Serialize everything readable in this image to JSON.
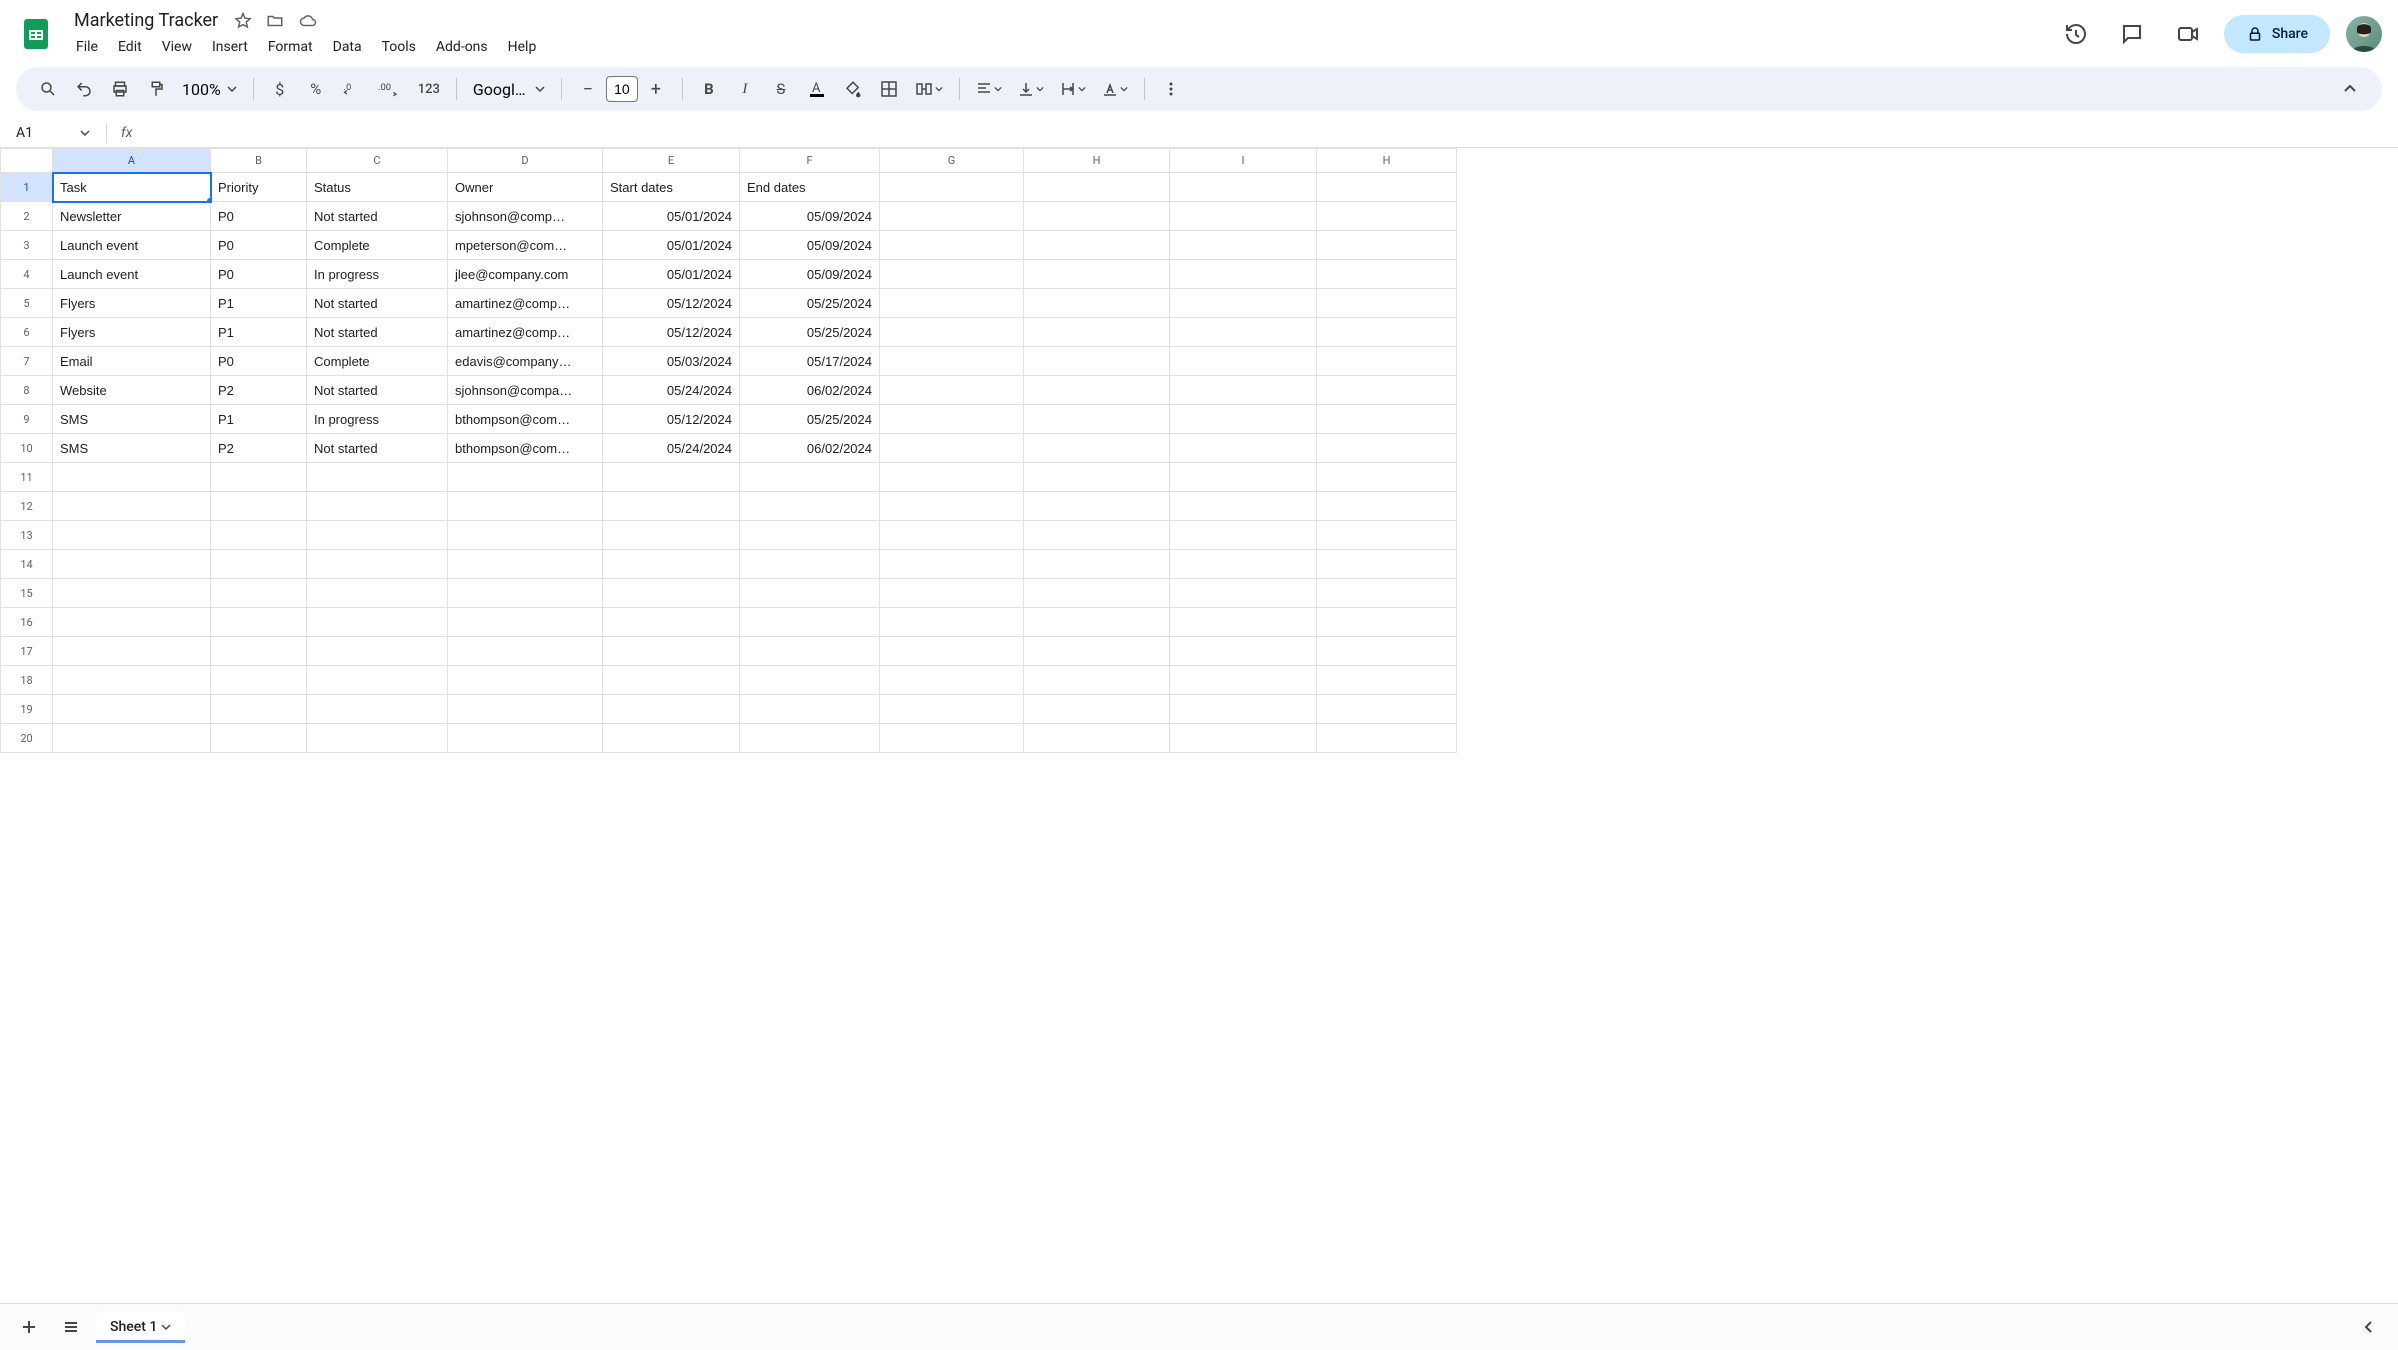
{
  "doc": {
    "title": "Marketing Tracker"
  },
  "menus": [
    "File",
    "Edit",
    "View",
    "Insert",
    "Format",
    "Data",
    "Tools",
    "Add-ons",
    "Help"
  ],
  "toolbar": {
    "zoom": "100%",
    "font": "Googl…",
    "font_size": "10"
  },
  "share": {
    "label": "Share"
  },
  "name_box": {
    "ref": "A1"
  },
  "columns": [
    "A",
    "B",
    "C",
    "D",
    "E",
    "F",
    "G",
    "H",
    "I",
    "H"
  ],
  "active_col": "A",
  "active_row": "1",
  "headers": {
    "A": "Task",
    "B": "Priority",
    "C": "Status",
    "D": "Owner",
    "E": "Start dates",
    "F": "End dates"
  },
  "rows": [
    {
      "A": "Newsletter",
      "B": "P0",
      "C": "Not started",
      "D": "sjohnson@comp…",
      "E": "05/01/2024",
      "F": "05/09/2024"
    },
    {
      "A": "Launch event",
      "B": "P0",
      "C": "Complete",
      "D": "mpeterson@com…",
      "E": "05/01/2024",
      "F": "05/09/2024"
    },
    {
      "A": "Launch event",
      "B": "P0",
      "C": "In progress",
      "D": "jlee@company.com",
      "E": "05/01/2024",
      "F": "05/09/2024"
    },
    {
      "A": "Flyers",
      "B": "P1",
      "C": "Not started",
      "D": "amartinez@comp…",
      "E": "05/12/2024",
      "F": "05/25/2024"
    },
    {
      "A": "Flyers",
      "B": "P1",
      "C": "Not started",
      "D": "amartinez@comp…",
      "E": "05/12/2024",
      "F": "05/25/2024"
    },
    {
      "A": "Email",
      "B": "P0",
      "C": "Complete",
      "D": "edavis@company…",
      "E": "05/03/2024",
      "F": "05/17/2024"
    },
    {
      "A": "Website",
      "B": "P2",
      "C": "Not started",
      "D": "sjohnson@compa…",
      "E": "05/24/2024",
      "F": "06/02/2024"
    },
    {
      "A": "SMS",
      "B": "P1",
      "C": "In progress",
      "D": "bthompson@com…",
      "E": "05/12/2024",
      "F": "05/25/2024"
    },
    {
      "A": "SMS",
      "B": "P2",
      "C": "Not started",
      "D": "bthompson@com…",
      "E": "05/24/2024",
      "F": "06/02/2024"
    }
  ],
  "total_rows": 20,
  "sheet_tab": {
    "name": "Sheet 1"
  }
}
